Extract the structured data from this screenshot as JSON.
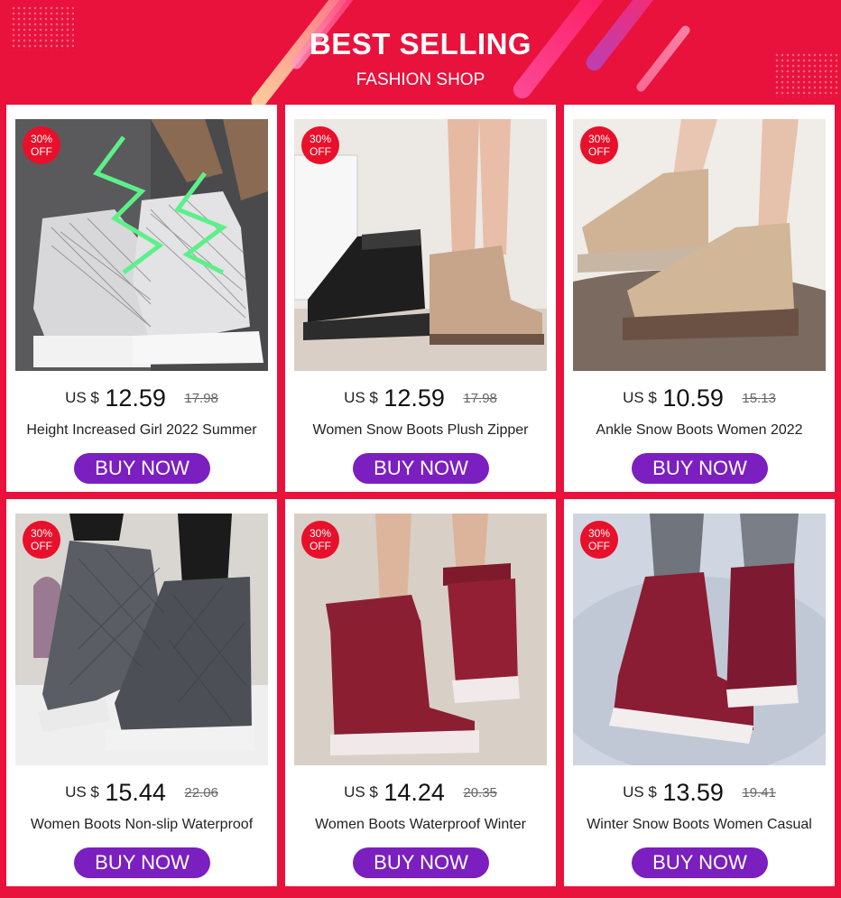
{
  "banner": {
    "title": "BEST SELLING",
    "subtitle": "FASHION SHOP"
  },
  "products": [
    {
      "badge_pct": "30%",
      "badge_off": "OFF",
      "currency": "US $",
      "price": "12.59",
      "old_price": "17.98",
      "title": "Height Increased Girl 2022 Summer",
      "button": "BUY NOW"
    },
    {
      "badge_pct": "30%",
      "badge_off": "OFF",
      "currency": "US $",
      "price": "12.59",
      "old_price": "17.98",
      "title": "Women Snow Boots Plush Zipper",
      "button": "BUY NOW"
    },
    {
      "badge_pct": "30%",
      "badge_off": "OFF",
      "currency": "US $",
      "price": "10.59",
      "old_price": "15.13",
      "title": "Ankle Snow Boots Women 2022",
      "button": "BUY NOW"
    },
    {
      "badge_pct": "30%",
      "badge_off": "OFF",
      "currency": "US $",
      "price": "15.44",
      "old_price": "22.06",
      "title": "Women Boots Non-slip Waterproof",
      "button": "BUY NOW"
    },
    {
      "badge_pct": "30%",
      "badge_off": "OFF",
      "currency": "US $",
      "price": "14.24",
      "old_price": "20.35",
      "title": "Women Boots Waterproof Winter",
      "button": "BUY NOW"
    },
    {
      "badge_pct": "30%",
      "badge_off": "OFF",
      "currency": "US $",
      "price": "13.59",
      "old_price": "19.41",
      "title": "Winter Snow Boots Women Casual",
      "button": "BUY NOW"
    }
  ],
  "colors": {
    "background": "#e8123c",
    "button": "#7b1fc0",
    "badge": "#e8102a"
  }
}
